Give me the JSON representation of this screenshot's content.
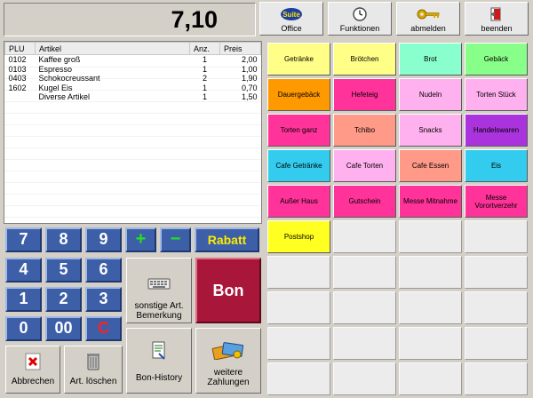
{
  "header": {
    "total": "7,10",
    "buttons": [
      {
        "label": "Office",
        "icon": "suite-logo-icon",
        "logo_text": "Suite"
      },
      {
        "label": "Funktionen",
        "icon": "clock-icon"
      },
      {
        "label": "abmelden",
        "icon": "key-icon"
      },
      {
        "label": "beenden",
        "icon": "exit-door-icon"
      }
    ]
  },
  "receipt": {
    "columns": [
      "PLU",
      "Artikel",
      "Anz.",
      "Preis"
    ],
    "rows": [
      {
        "plu": "0102",
        "artikel": "Kaffee groß",
        "anz": "1",
        "preis": "2,00"
      },
      {
        "plu": "0103",
        "artikel": "Espresso",
        "anz": "1",
        "preis": "1,00"
      },
      {
        "plu": "0403",
        "artikel": "Schokocreussant",
        "anz": "2",
        "preis": "1,90"
      },
      {
        "plu": "1602",
        "artikel": "Kugel Eis",
        "anz": "1",
        "preis": "0,70"
      },
      {
        "plu": "",
        "artikel": "Diverse Artikel",
        "anz": "1",
        "preis": "1,50"
      }
    ]
  },
  "keypad": {
    "k7": "7",
    "k8": "8",
    "k9": "9",
    "plus": "+",
    "minus": "−",
    "rabatt": "Rabatt",
    "k4": "4",
    "k5": "5",
    "k6": "6",
    "k1": "1",
    "k2": "2",
    "k3": "3",
    "k0": "0",
    "k00": "00",
    "clear": "C"
  },
  "actions": {
    "bemerkung": "sonstige Art. Bemerkung",
    "bon": "Bon",
    "abbrechen": "Abbrechen",
    "loeschen": "Art. löschen",
    "history": "Bon-History",
    "zahlungen": "weitere Zahlungen"
  },
  "categories": [
    {
      "label": "Getränke",
      "color": "#ffff88"
    },
    {
      "label": "Brötchen",
      "color": "#ffff88"
    },
    {
      "label": "Brot",
      "color": "#88ffcc"
    },
    {
      "label": "Gebäck",
      "color": "#88ff88"
    },
    {
      "label": "Dauergebäck",
      "color": "#ff9900"
    },
    {
      "label": "Hefeteig",
      "color": "#ff3399"
    },
    {
      "label": "Nudeln",
      "color": "#ffb0ee"
    },
    {
      "label": "Torten Stück",
      "color": "#ffb0ee"
    },
    {
      "label": "Torten ganz",
      "color": "#ff3399"
    },
    {
      "label": "Tchibo",
      "color": "#ff9988"
    },
    {
      "label": "Snacks",
      "color": "#ffb0ee"
    },
    {
      "label": "Handelswaren",
      "color": "#aa33dd"
    },
    {
      "label": "Cafe Getränke",
      "color": "#33ccee"
    },
    {
      "label": "Cafe Torten",
      "color": "#ffb0ee"
    },
    {
      "label": "Cafe Essen",
      "color": "#ff9988"
    },
    {
      "label": "Eis",
      "color": "#33ccee"
    },
    {
      "label": "Außer Haus",
      "color": "#ff3399"
    },
    {
      "label": "Gutschein",
      "color": "#ff3399"
    },
    {
      "label": "Messe Mitnahme",
      "color": "#ff3399"
    },
    {
      "label": "Messe Vorortverzehr",
      "color": "#ff3399"
    },
    {
      "label": "Postshop",
      "color": "#ffff22"
    },
    {
      "label": "",
      "color": ""
    },
    {
      "label": "",
      "color": ""
    },
    {
      "label": "",
      "color": ""
    },
    {
      "label": "",
      "color": ""
    },
    {
      "label": "",
      "color": ""
    },
    {
      "label": "",
      "color": ""
    },
    {
      "label": "",
      "color": ""
    },
    {
      "label": "",
      "color": ""
    },
    {
      "label": "",
      "color": ""
    },
    {
      "label": "",
      "color": ""
    },
    {
      "label": "",
      "color": ""
    },
    {
      "label": "",
      "color": ""
    },
    {
      "label": "",
      "color": ""
    },
    {
      "label": "",
      "color": ""
    },
    {
      "label": "",
      "color": ""
    },
    {
      "label": "",
      "color": ""
    },
    {
      "label": "",
      "color": ""
    },
    {
      "label": "",
      "color": ""
    },
    {
      "label": "",
      "color": ""
    }
  ]
}
